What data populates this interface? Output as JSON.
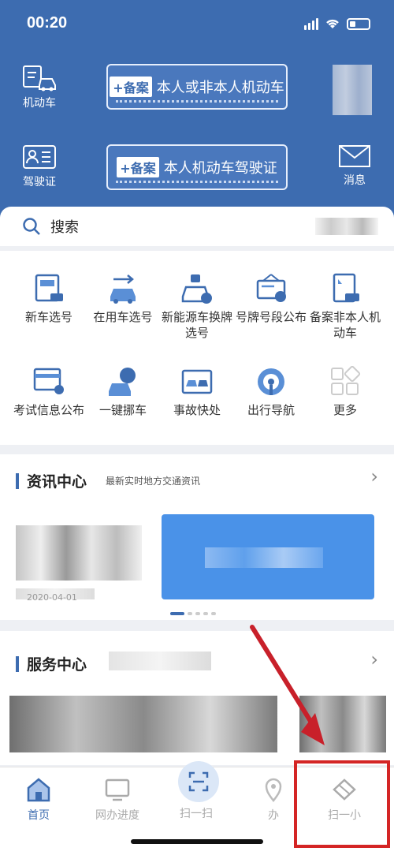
{
  "status": {
    "time": "00:20"
  },
  "header": {
    "left_items": [
      {
        "label": "机动车",
        "icon": "vehicle-doc-icon"
      },
      {
        "label": "驾驶证",
        "icon": "license-card-icon"
      }
    ],
    "banners": [
      {
        "tag": "+备案",
        "text": "本人或非本人机动车"
      },
      {
        "tag": "+备案",
        "text": "本人机动车驾驶证"
      }
    ],
    "message_label": "消息"
  },
  "search": {
    "label": "搜索"
  },
  "services": [
    {
      "label": "新车选号",
      "icon": "new-car-icon"
    },
    {
      "label": "在用车选号",
      "icon": "used-car-icon"
    },
    {
      "label": "新能源车换牌选号",
      "icon": "ev-car-icon"
    },
    {
      "label": "号牌号段公布",
      "icon": "plate-sign-icon"
    },
    {
      "label": "备案非本人机动车",
      "icon": "record-car-icon"
    },
    {
      "label": "考试信息公布",
      "icon": "exam-info-icon"
    },
    {
      "label": "一键挪车",
      "icon": "move-car-icon"
    },
    {
      "label": "事故快处",
      "icon": "accident-icon"
    },
    {
      "label": "出行导航",
      "icon": "navigation-icon"
    },
    {
      "label": "更多",
      "icon": "more-grid-icon"
    }
  ],
  "news": {
    "title": "资讯中心",
    "subtitle": "最新实时地方交通资讯",
    "date": "2020-04-01"
  },
  "service_center": {
    "title": "服务中心"
  },
  "tabbar": [
    {
      "label": "首页",
      "icon": "home-icon"
    },
    {
      "label": "网办进度",
      "icon": "monitor-icon"
    },
    {
      "label": "扫一扫",
      "icon": "scan-icon"
    },
    {
      "label": "办",
      "icon": "location-icon"
    },
    {
      "label": "扫一小",
      "icon": "diamond-icon"
    }
  ],
  "colors": {
    "primary": "#3d6cb0",
    "highlight": "#d42525"
  }
}
